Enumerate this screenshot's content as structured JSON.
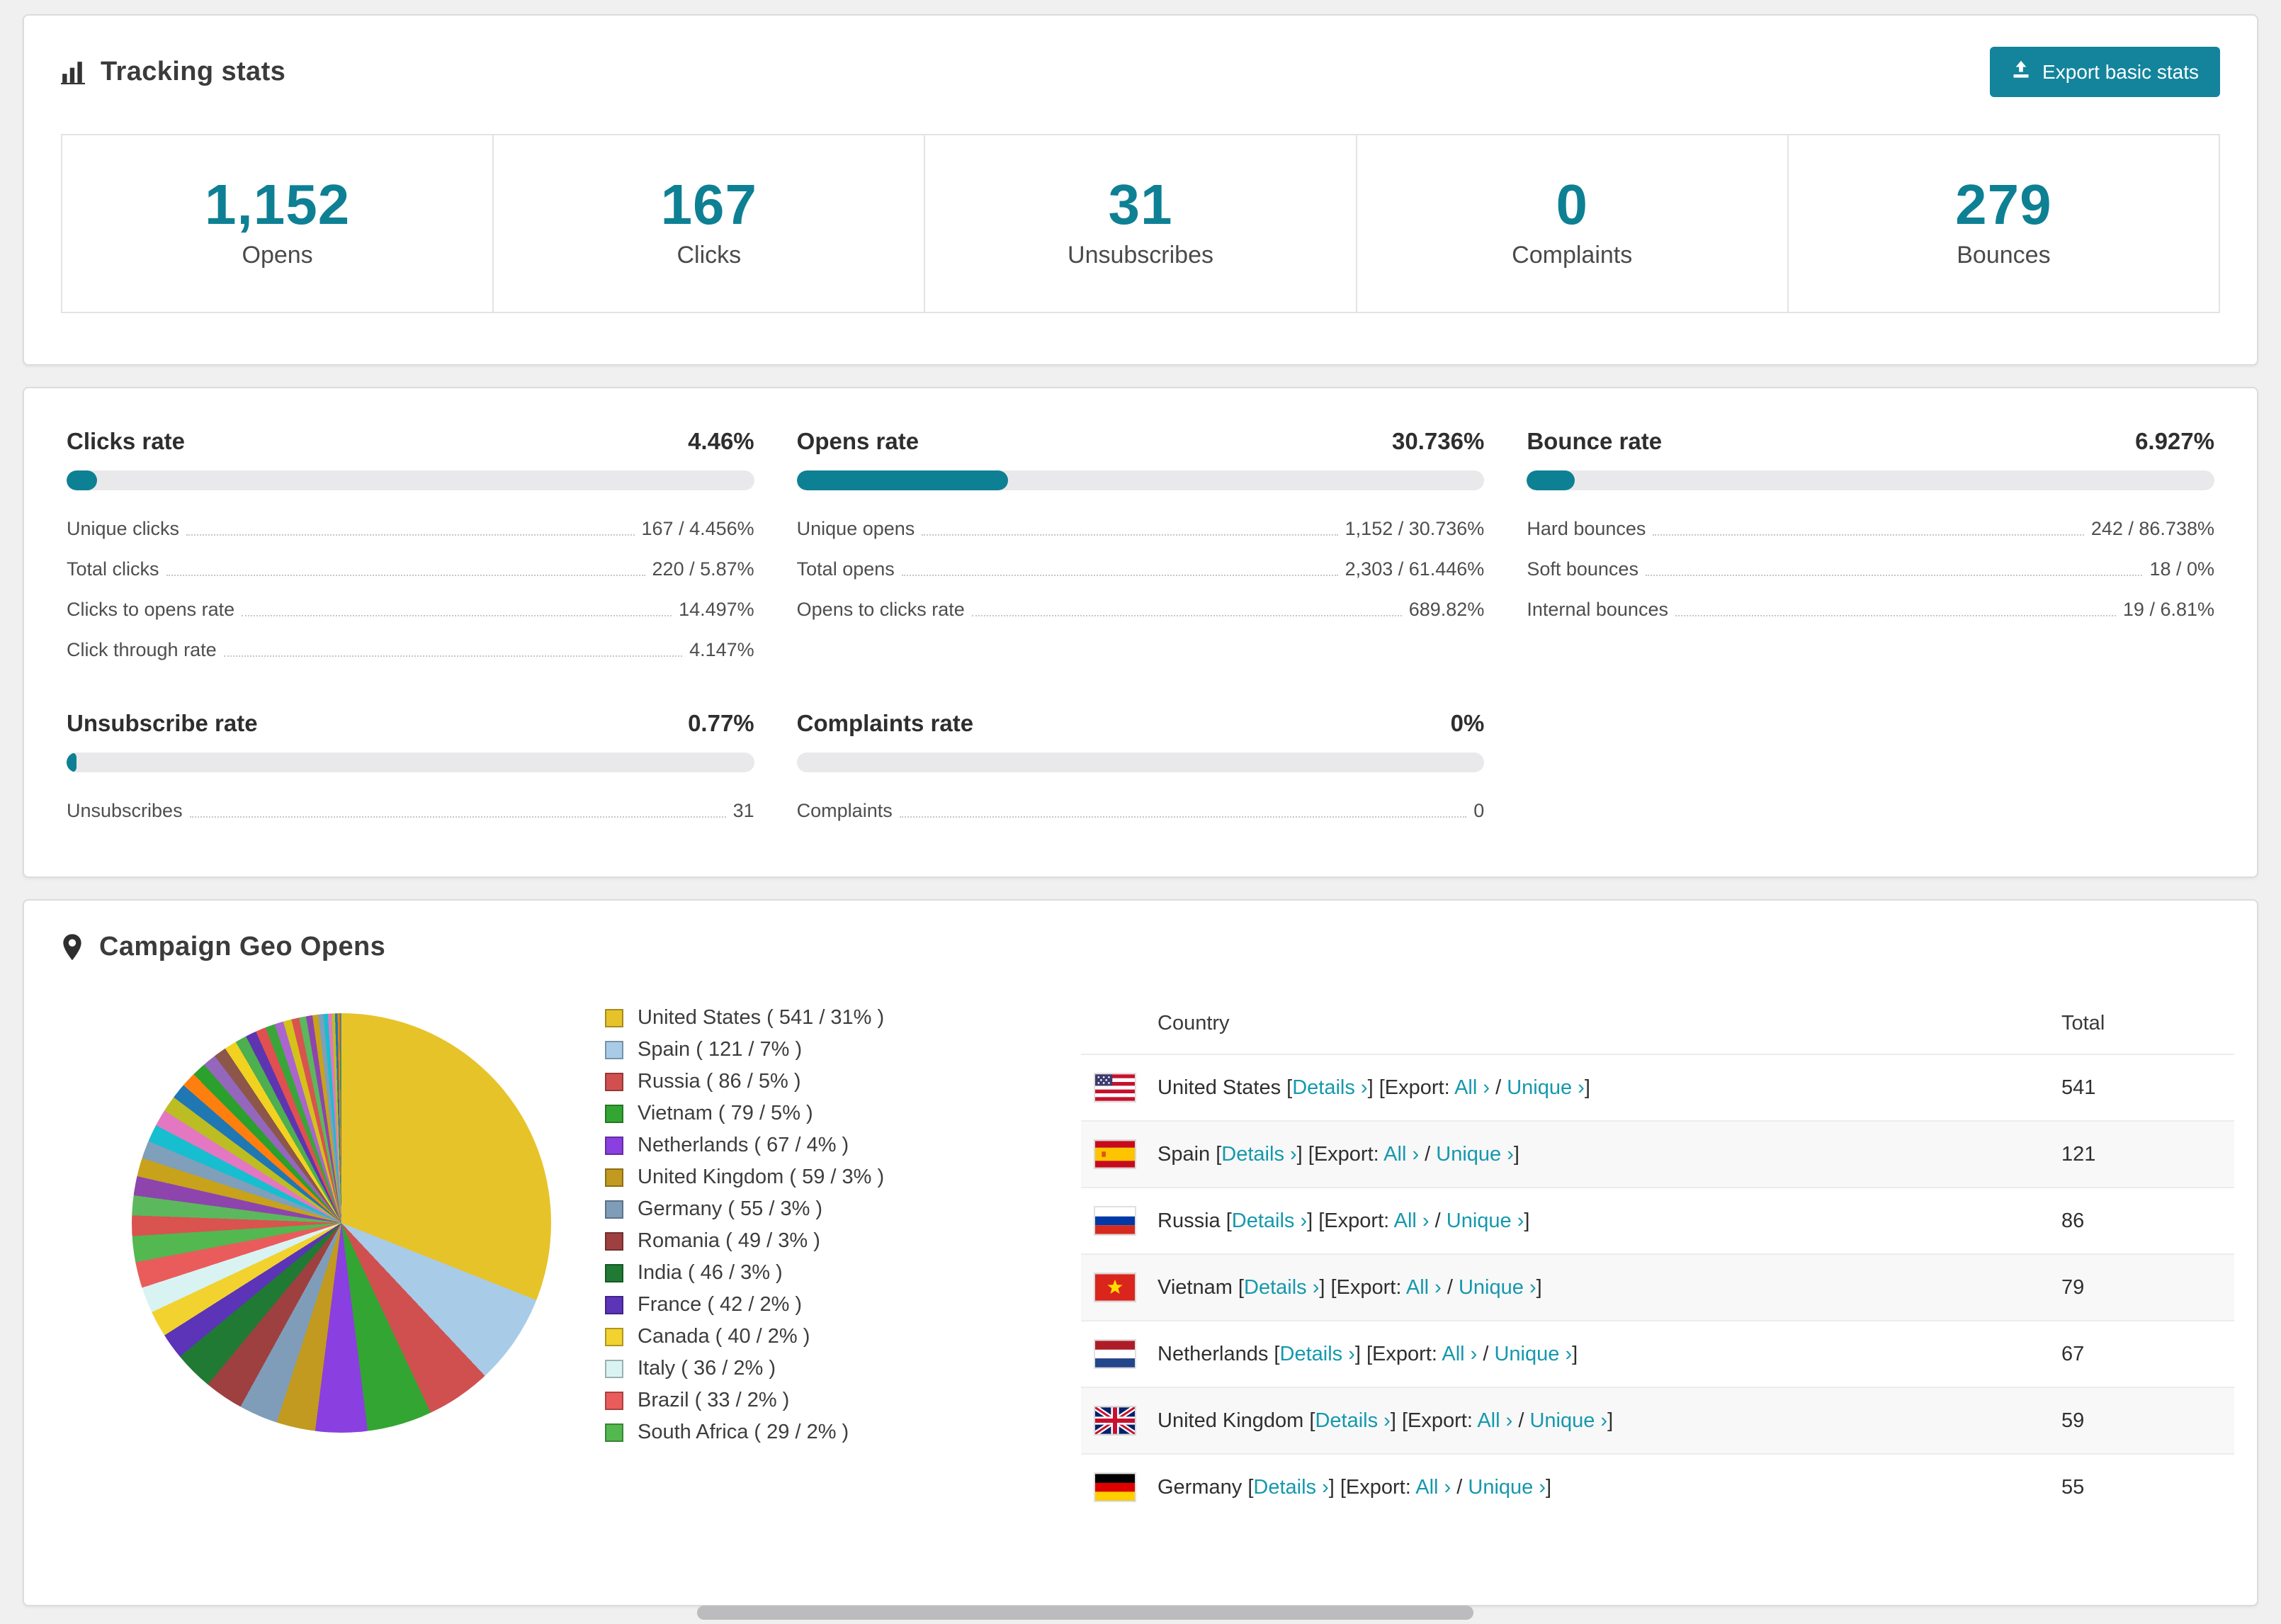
{
  "colors": {
    "accent": "#0e8094",
    "button": "#13849c",
    "link": "#1598ad",
    "bar_track": "#e9e9ec"
  },
  "tracking": {
    "title": "Tracking stats",
    "export_button": "Export basic stats",
    "stats": [
      {
        "value": "1,152",
        "label": "Opens"
      },
      {
        "value": "167",
        "label": "Clicks"
      },
      {
        "value": "31",
        "label": "Unsubscribes"
      },
      {
        "value": "0",
        "label": "Complaints"
      },
      {
        "value": "279",
        "label": "Bounces"
      }
    ]
  },
  "rates": [
    {
      "title": "Clicks rate",
      "value": "4.46%",
      "percent": 4.46,
      "rows": [
        {
          "label": "Unique clicks",
          "value": "167 / 4.456%"
        },
        {
          "label": "Total clicks",
          "value": "220 / 5.87%"
        },
        {
          "label": "Clicks to opens rate",
          "value": "14.497%"
        },
        {
          "label": "Click through rate",
          "value": "4.147%"
        }
      ]
    },
    {
      "title": "Opens rate",
      "value": "30.736%",
      "percent": 30.736,
      "rows": [
        {
          "label": "Unique opens",
          "value": "1,152 / 30.736%"
        },
        {
          "label": "Total opens",
          "value": "2,303 / 61.446%"
        },
        {
          "label": "Opens to clicks rate",
          "value": "689.82%"
        }
      ]
    },
    {
      "title": "Bounce rate",
      "value": "6.927%",
      "percent": 6.927,
      "rows": [
        {
          "label": "Hard bounces",
          "value": "242 / 86.738%"
        },
        {
          "label": "Soft bounces",
          "value": "18 / 0%"
        },
        {
          "label": "Internal bounces",
          "value": "19 / 6.81%"
        }
      ]
    },
    {
      "title": "Unsubscribe rate",
      "value": "0.77%",
      "percent": 0.77,
      "rows": [
        {
          "label": "Unsubscribes",
          "value": "31"
        }
      ]
    },
    {
      "title": "Complaints rate",
      "value": "0%",
      "percent": 0,
      "rows": [
        {
          "label": "Complaints",
          "value": "0"
        }
      ]
    }
  ],
  "geo": {
    "title": "Campaign Geo Opens",
    "chart_data": {
      "type": "pie",
      "title": "Campaign Geo Opens",
      "legend_position": "right",
      "slices": [
        {
          "label": "United States",
          "value": 541,
          "percent": 31,
          "color": "#e7c32a"
        },
        {
          "label": "Spain",
          "value": 121,
          "percent": 7,
          "color": "#a8cbe8"
        },
        {
          "label": "Russia",
          "value": 86,
          "percent": 5,
          "color": "#d05050"
        },
        {
          "label": "Vietnam",
          "value": 79,
          "percent": 5,
          "color": "#33a532"
        },
        {
          "label": "Netherlands",
          "value": 67,
          "percent": 4,
          "color": "#8a3fe0"
        },
        {
          "label": "United Kingdom",
          "value": 59,
          "percent": 3,
          "color": "#c19a1f"
        },
        {
          "label": "Germany",
          "value": 55,
          "percent": 3,
          "color": "#7f9db9"
        },
        {
          "label": "Romania",
          "value": 49,
          "percent": 3,
          "color": "#9e4040"
        },
        {
          "label": "India",
          "value": 46,
          "percent": 3,
          "color": "#207a33"
        },
        {
          "label": "France",
          "value": 42,
          "percent": 2,
          "color": "#5b34b8"
        },
        {
          "label": "Canada",
          "value": 40,
          "percent": 2,
          "color": "#f2d22e"
        },
        {
          "label": "Italy",
          "value": 36,
          "percent": 2,
          "color": "#d9f3f3"
        },
        {
          "label": "Brazil",
          "value": 33,
          "percent": 2,
          "color": "#ea5c5c"
        },
        {
          "label": "South Africa",
          "value": 29,
          "percent": 2,
          "color": "#52b84f"
        }
      ],
      "others_percent": 26,
      "others_palette": [
        "#d9534f",
        "#5cb85c",
        "#8e44ad",
        "#c8a21a",
        "#7f9fba",
        "#17becf",
        "#e377c2",
        "#bcbd22",
        "#1f77b4",
        "#ff7f0e",
        "#2ca02c",
        "#9467bd",
        "#8c564b",
        "#f1d221",
        "#4caf50",
        "#5e35b1",
        "#e05050",
        "#3aa63a",
        "#aa66cc",
        "#d4c21a"
      ]
    },
    "table": {
      "headers": [
        "Country",
        "Total"
      ],
      "link_labels": {
        "details": "Details",
        "export": "Export:",
        "all": "All",
        "unique": "Unique",
        "chevron": "›"
      },
      "rows": [
        {
          "flag": "us",
          "country": "United States",
          "total": "541"
        },
        {
          "flag": "es",
          "country": "Spain",
          "total": "121"
        },
        {
          "flag": "ru",
          "country": "Russia",
          "total": "86"
        },
        {
          "flag": "vn",
          "country": "Vietnam",
          "total": "79"
        },
        {
          "flag": "nl",
          "country": "Netherlands",
          "total": "67"
        },
        {
          "flag": "gb",
          "country": "United Kingdom",
          "total": "59"
        },
        {
          "flag": "de",
          "country": "Germany",
          "total": "55"
        }
      ]
    }
  }
}
